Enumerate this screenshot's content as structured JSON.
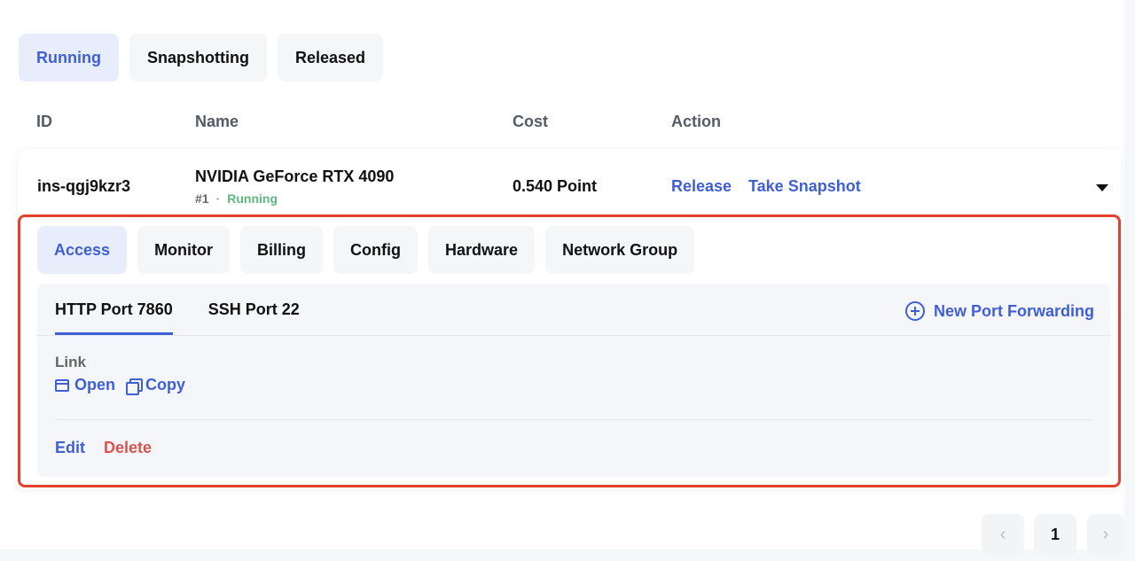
{
  "status_tabs": [
    {
      "label": "Running",
      "active": true
    },
    {
      "label": "Snapshotting",
      "active": false
    },
    {
      "label": "Released",
      "active": false
    }
  ],
  "table": {
    "headers": {
      "id": "ID",
      "name": "Name",
      "cost": "Cost",
      "action": "Action"
    }
  },
  "instance": {
    "id": "ins-qgj9kzr3",
    "gpu": "NVIDIA GeForce RTX 4090",
    "index": "#1",
    "separator": "·",
    "status": "Running",
    "cost": "0.540 Point",
    "actions": {
      "release": "Release",
      "snapshot": "Take Snapshot"
    }
  },
  "detail_tabs": [
    {
      "label": "Access",
      "active": true
    },
    {
      "label": "Monitor",
      "active": false
    },
    {
      "label": "Billing",
      "active": false
    },
    {
      "label": "Config",
      "active": false
    },
    {
      "label": "Hardware",
      "active": false
    },
    {
      "label": "Network Group",
      "active": false
    }
  ],
  "access": {
    "port_tabs": [
      {
        "label": "HTTP Port 7860",
        "active": true
      },
      {
        "label": "SSH Port 22",
        "active": false
      }
    ],
    "new_port_label": "New Port Forwarding",
    "link_label": "Link",
    "open_label": "Open",
    "copy_label": "Copy",
    "edit_label": "Edit",
    "delete_label": "Delete"
  },
  "pagination": {
    "prev": "‹",
    "current": "1",
    "next": "›"
  },
  "colors": {
    "accent": "#3f5fd6",
    "running": "#5cb87a",
    "danger": "#d9534f",
    "highlight_border": "#e5412d"
  }
}
